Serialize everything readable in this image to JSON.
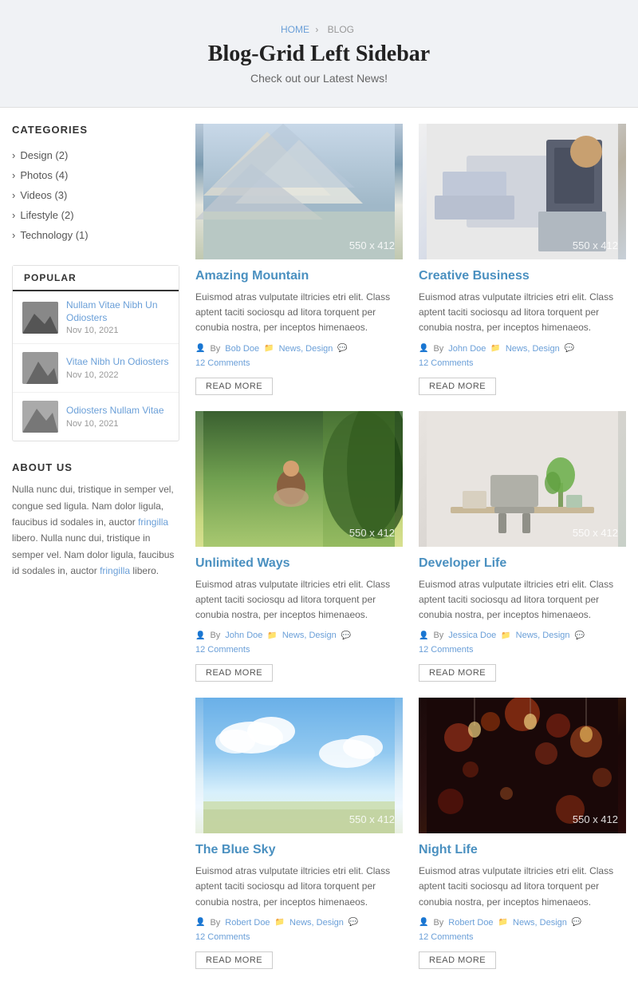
{
  "header": {
    "breadcrumb": {
      "home": "HOME",
      "separator": "›",
      "current": "BLOG"
    },
    "title": "Blog-Grid Left Sidebar",
    "subtitle": "Check out our Latest News!"
  },
  "sidebar": {
    "categories_title": "CATEGORIES",
    "categories": [
      {
        "label": "Design (2)"
      },
      {
        "label": "Photos (4)"
      },
      {
        "label": "Videos (3)"
      },
      {
        "label": "Lifestyle (2)"
      },
      {
        "label": "Technology (1)"
      }
    ],
    "popular_tab": "POPULAR",
    "popular_posts": [
      {
        "title": "Nullam Vitae Nibh Un Odiosters",
        "date": "Nov 10, 2021"
      },
      {
        "title": "Vitae Nibh Un Odiosters",
        "date": "Nov 10, 2022"
      },
      {
        "title": "Odiosters Nullam Vitae",
        "date": "Nov 10, 2021"
      }
    ],
    "about_title": "ABOUT US",
    "about_text": "Nulla nunc dui, tristique in semper vel, congue sed ligula. Nam dolor ligula, faucibus id sodales in, auctor fringilla libero. Nulla nunc dui, tristique in semper vel. Nam dolor ligula, faucibus id sodales in, auctor fringilla libero."
  },
  "blog": {
    "posts": [
      {
        "title": "Amazing Mountain",
        "excerpt": "Euismod atras vulputate iltricies etri elit. Class aptent taciti sociosqu ad litora torquent per conubia nostra, per inceptos himenaeos.",
        "author": "Bob Doe",
        "categories": "News, Design",
        "comments": "12 Comments",
        "img_type": "mountain",
        "img_label": "550 x 412"
      },
      {
        "title": "Creative Business",
        "excerpt": "Euismod atras vulputate iltricies etri elit. Class aptent taciti sociosqu ad litora torquent per conubia nostra, per inceptos himenaeos.",
        "author": "John Doe",
        "categories": "News, Design",
        "comments": "12 Comments",
        "img_type": "business",
        "img_label": "550 x 412"
      },
      {
        "title": "Unlimited Ways",
        "excerpt": "Euismod atras vulputate iltricies etri elit. Class aptent taciti sociosqu ad litora torquent per conubia nostra, per inceptos himenaeos.",
        "author": "John Doe",
        "categories": "News, Design",
        "comments": "12 Comments",
        "img_type": "reading",
        "img_label": "550 x 412"
      },
      {
        "title": "Developer Life",
        "excerpt": "Euismod atras vulputate iltricies etri elit. Class aptent taciti sociosqu ad litora torquent per conubia nostra, per inceptos himenaeos.",
        "author": "Jessica Doe",
        "categories": "News, Design",
        "comments": "12 Comments",
        "img_type": "office",
        "img_label": "550 x 412"
      },
      {
        "title": "The Blue Sky",
        "excerpt": "Euismod atras vulputate iltricies etri elit. Class aptent taciti sociosqu ad litora torquent per conubia nostra, per inceptos himenaeos.",
        "author": "Robert Doe",
        "categories": "News, Design",
        "comments": "12 Comments",
        "img_type": "sky",
        "img_label": "550 x 412"
      },
      {
        "title": "Night Life",
        "excerpt": "Euismod atras vulputate iltricies etri elit. Class aptent taciti sociosqu ad litora torquent per conubia nostra, per inceptos himenaeos.",
        "author": "Robert Doe",
        "categories": "News, Design",
        "comments": "12 Comments",
        "img_type": "night",
        "img_label": "550 x 412"
      }
    ],
    "read_more_label": "READ MORE"
  }
}
